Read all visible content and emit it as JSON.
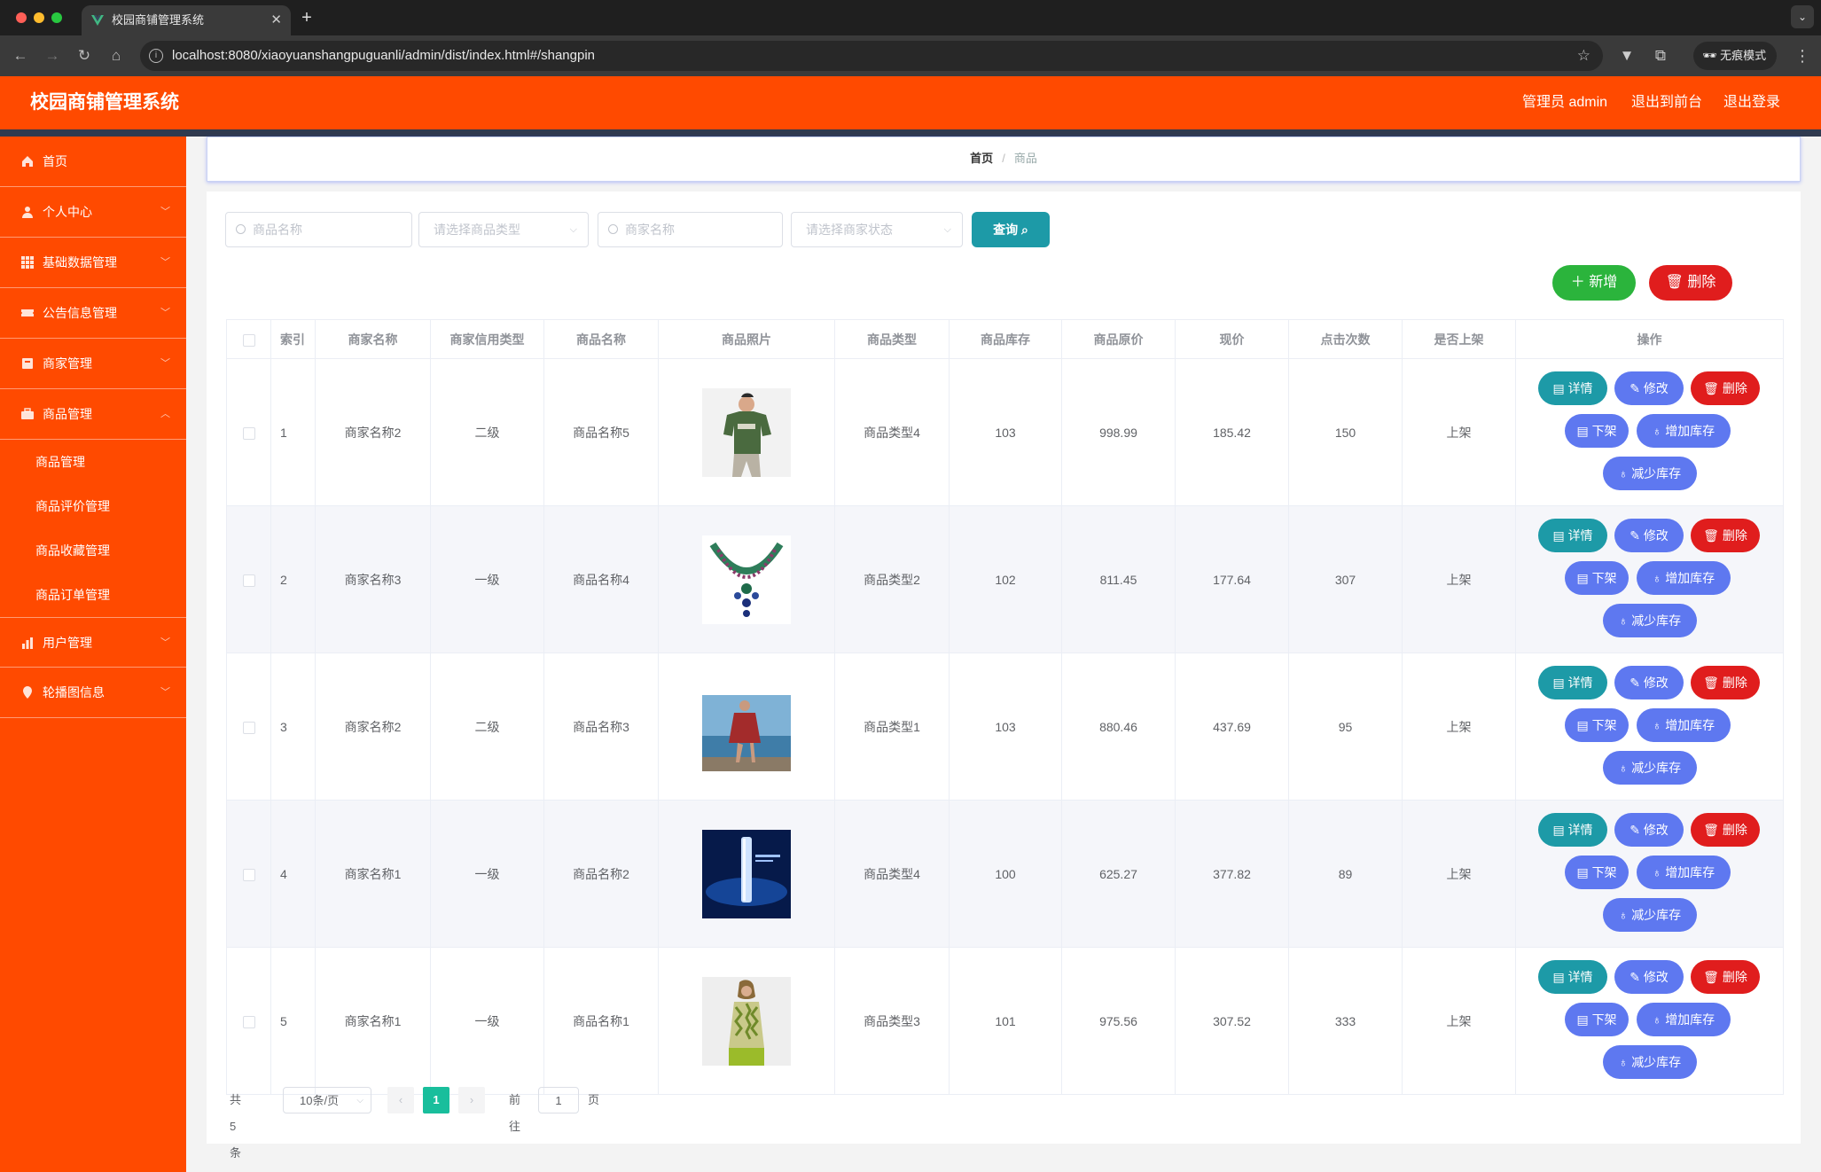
{
  "browser": {
    "tab_title": "校园商铺管理系统",
    "url": "localhost:8080/xiaoyuanshangpuguanli/admin/dist/index.html#/shangpin",
    "incognito_label": "无痕模式"
  },
  "header": {
    "title": "校园商铺管理系统",
    "user": "管理员 admin",
    "to_front": "退出到前台",
    "logout": "退出登录"
  },
  "sidebar": {
    "items": [
      {
        "label": "首页",
        "icon": "home-icon"
      },
      {
        "label": "个人中心",
        "icon": "user-icon"
      },
      {
        "label": "基础数据管理",
        "icon": "grid-icon"
      },
      {
        "label": "公告信息管理",
        "icon": "ticket-icon"
      },
      {
        "label": "商家管理",
        "icon": "store-icon"
      },
      {
        "label": "商品管理",
        "icon": "briefcase-icon"
      },
      {
        "label": "用户管理",
        "icon": "bar-chart-icon"
      },
      {
        "label": "轮播图信息",
        "icon": "location-icon"
      }
    ],
    "sub_items": [
      "商品管理",
      "商品评价管理",
      "商品收藏管理",
      "商品订单管理"
    ]
  },
  "breadcrumb": {
    "home": "首页",
    "sep": "/",
    "current": "商品"
  },
  "search": {
    "product_name_placeholder": "商品名称",
    "product_type_placeholder": "请选择商品类型",
    "merchant_name_placeholder": "商家名称",
    "merchant_status_placeholder": "请选择商家状态",
    "query_label": "查询"
  },
  "actions": {
    "add": "新增",
    "delete": "删除"
  },
  "table": {
    "columns": [
      "索引",
      "商家名称",
      "商家信用类型",
      "商品名称",
      "商品照片",
      "商品类型",
      "商品库存",
      "商品原价",
      "现价",
      "点击次数",
      "是否上架",
      "操作"
    ],
    "rows": [
      {
        "idx": "1",
        "merchant": "商家名称2",
        "credit": "二级",
        "name": "商品名称5",
        "photo": "green-tshirt",
        "type": "商品类型4",
        "stock": "103",
        "orig": "998.99",
        "price": "185.42",
        "clicks": "150",
        "listed": "上架"
      },
      {
        "idx": "2",
        "merchant": "商家名称3",
        "credit": "一级",
        "name": "商品名称4",
        "photo": "emerald-necklace",
        "type": "商品类型2",
        "stock": "102",
        "orig": "811.45",
        "price": "177.64",
        "clicks": "307",
        "listed": "上架"
      },
      {
        "idx": "3",
        "merchant": "商家名称2",
        "credit": "二级",
        "name": "商品名称3",
        "photo": "red-dress-seaside",
        "type": "商品类型1",
        "stock": "103",
        "orig": "880.46",
        "price": "437.69",
        "clicks": "95",
        "listed": "上架"
      },
      {
        "idx": "4",
        "merchant": "商家名称1",
        "credit": "一级",
        "name": "商品名称2",
        "photo": "blue-serum-ad",
        "type": "商品类型4",
        "stock": "100",
        "orig": "625.27",
        "price": "377.82",
        "clicks": "89",
        "listed": "上架"
      },
      {
        "idx": "5",
        "merchant": "商家名称1",
        "credit": "一级",
        "name": "商品名称1",
        "photo": "green-print-dress",
        "type": "商品类型3",
        "stock": "101",
        "orig": "975.56",
        "price": "307.52",
        "clicks": "333",
        "listed": "上架"
      }
    ],
    "row_buttons": {
      "detail": "详情",
      "edit": "修改",
      "delete": "删除",
      "offshelf": "下架",
      "add_stock": "增加库存",
      "reduce_stock": "减少库存"
    }
  },
  "pagination": {
    "total": "共 5 条",
    "page_size": "10条/页",
    "current": "1",
    "goto": "前往",
    "goto_value": "1",
    "page_unit": "页"
  },
  "colors": {
    "brand": "#ff4a00",
    "teal": "#1d9aa7",
    "blue": "#5e78f0",
    "red": "#e01d1d",
    "green": "#2bb43c"
  }
}
